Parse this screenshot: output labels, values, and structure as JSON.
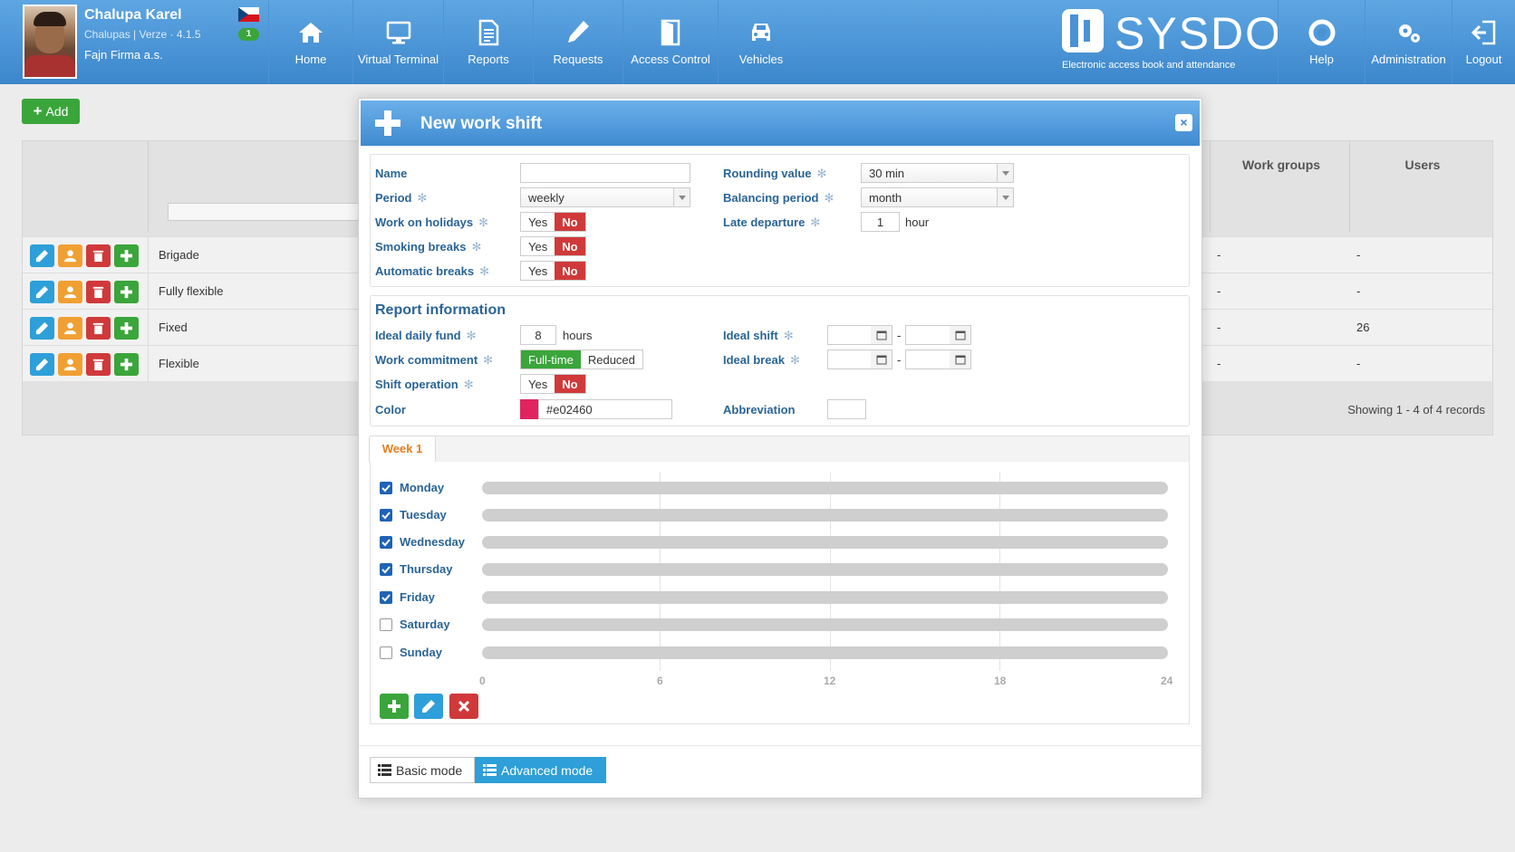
{
  "user": {
    "name": "Chalupa Karel",
    "subtitle": "Chalupas | Verze · 4.1.5",
    "company": "Fajn Firma a.s.",
    "notifications": "1"
  },
  "nav_left": [
    {
      "label": "Home",
      "icon": "home-icon"
    },
    {
      "label": "Virtual Terminal",
      "icon": "monitor-icon"
    },
    {
      "label": "Reports",
      "icon": "document-icon"
    },
    {
      "label": "Requests",
      "icon": "pencil-icon"
    },
    {
      "label": "Access Control",
      "icon": "door-icon"
    },
    {
      "label": "Vehicles",
      "icon": "car-icon"
    }
  ],
  "brand": {
    "name": "SYSDO",
    "tagline": "Electronic access book and attendance"
  },
  "nav_right": [
    {
      "label": "Help",
      "icon": "lifebuoy-icon"
    },
    {
      "label": "Administration",
      "icon": "gears-icon"
    },
    {
      "label": "Logout",
      "icon": "logout-icon"
    }
  ],
  "page": {
    "add_label": "Add",
    "columns": {
      "work_groups": "Work groups",
      "users": "Users"
    },
    "rows": [
      {
        "name": "Brigade",
        "work_groups": "-",
        "users": "-"
      },
      {
        "name": "Fully flexible",
        "work_groups": "-",
        "users": "-"
      },
      {
        "name": "Fixed",
        "work_groups": "-",
        "users": "26"
      },
      {
        "name": "Flexible",
        "work_groups": "-",
        "users": "-"
      }
    ],
    "records": "Showing 1 - 4 of 4 records"
  },
  "modal": {
    "title": "New work shift",
    "labels": {
      "name": "Name",
      "period": "Period",
      "work_on_holidays": "Work on holidays",
      "smoking_breaks": "Smoking breaks",
      "automatic_breaks": "Automatic breaks",
      "rounding_value": "Rounding value",
      "balancing_period": "Balancing period",
      "late_departure": "Late departure",
      "ideal_daily_fund": "Ideal daily fund",
      "work_commitment": "Work commitment",
      "shift_operation": "Shift operation",
      "color": "Color",
      "ideal_shift": "Ideal shift",
      "ideal_break": "Ideal break",
      "abbreviation": "Abbreviation"
    },
    "values": {
      "name": "",
      "period": "weekly",
      "rounding_value": "30 min",
      "balancing_period": "month",
      "late_departure": "1",
      "late_departure_unit": "hour",
      "ideal_daily_fund": "8",
      "ideal_daily_fund_unit": "hours",
      "color": "#e02460",
      "abbreviation": ""
    },
    "yes": "Yes",
    "no": "No",
    "full_time": "Full-time",
    "reduced": "Reduced",
    "report_section": "Report information",
    "week_tab": "Week 1",
    "days": [
      {
        "label": "Monday",
        "checked": true
      },
      {
        "label": "Tuesday",
        "checked": true
      },
      {
        "label": "Wednesday",
        "checked": true
      },
      {
        "label": "Thursday",
        "checked": true
      },
      {
        "label": "Friday",
        "checked": true
      },
      {
        "label": "Saturday",
        "checked": false
      },
      {
        "label": "Sunday",
        "checked": false
      }
    ],
    "ticks": [
      "0",
      "6",
      "12",
      "18",
      "24"
    ],
    "basic_mode": "Basic mode",
    "advanced_mode": "Advanced mode"
  },
  "colors": {
    "accent": "#3f8ad0",
    "green": "#3aa53a",
    "red": "#d0393a",
    "orange": "#f0a033",
    "blue": "#2e9fd8"
  }
}
